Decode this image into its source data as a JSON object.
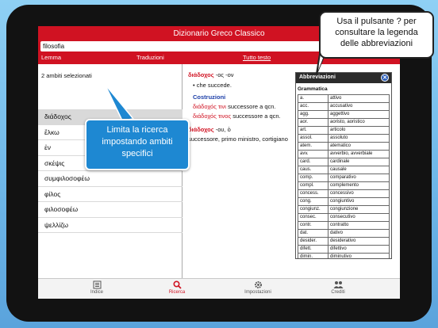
{
  "header": {
    "title": "Dizionario Greco Classico"
  },
  "search": {
    "value": "filosofia"
  },
  "tabs": [
    {
      "label": "Lemma"
    },
    {
      "label": "Traduzioni"
    },
    {
      "label": "Tutto testo"
    }
  ],
  "left_pane": {
    "ambiti_label": "2 ambiti selezionati",
    "words": [
      "διάδοχος",
      "ἕλκω",
      "ἐν",
      "σκέψις",
      "συμφιλοσοφέω",
      "φίλος",
      "φιλοσοφέω",
      "ψελλίζω"
    ]
  },
  "entry": {
    "headword": "διάδοχος",
    "inflection": "-ος -ον",
    "bullet": "• che succede.",
    "costruzioni_label": "Costruzioni",
    "constructions": [
      {
        "greek": "διάδοχός τινι",
        "translation": "successore a qcn."
      },
      {
        "greek": "διάδοχός τινος",
        "translation": "successore a qcn."
      }
    ],
    "noun_headword": "διάδοχος",
    "noun_inflection": "-ου, ὁ",
    "noun_meaning": "successore, primo ministro, cortigiano"
  },
  "abbreviations": {
    "title": "Abbreviazioni",
    "close_icon": "close-icon",
    "section": "Grammatica",
    "rows": [
      [
        "a.",
        "attivo"
      ],
      [
        "acc.",
        "accusativo"
      ],
      [
        "agg.",
        "aggettivo"
      ],
      [
        "aor.",
        "aoristo, aoristico"
      ],
      [
        "art.",
        "articolo"
      ],
      [
        "assol.",
        "assoluto"
      ],
      [
        "atem.",
        "atematico"
      ],
      [
        "avv.",
        "avverbio, avverbiale"
      ],
      [
        "card.",
        "cardinale"
      ],
      [
        "caus.",
        "causale"
      ],
      [
        "comp.",
        "comparativo"
      ],
      [
        "compl.",
        "complemento"
      ],
      [
        "concess.",
        "concessivo"
      ],
      [
        "cong.",
        "congiuntivo"
      ],
      [
        "congiunz.",
        "congiunzione"
      ],
      [
        "consec.",
        "consecutivo"
      ],
      [
        "contr.",
        "contratto"
      ],
      [
        "dat.",
        "dativo"
      ],
      [
        "desider.",
        "desiderativo"
      ],
      [
        "difett.",
        "difettivo"
      ],
      [
        "dimin.",
        "diminutivo"
      ],
      [
        "dimostr.",
        "dimostrativo"
      ]
    ]
  },
  "tabbar": [
    {
      "label": "Indice",
      "icon": "index-icon"
    },
    {
      "label": "Ricerca",
      "icon": "search-icon"
    },
    {
      "label": "Impostazioni",
      "icon": "gear-icon"
    },
    {
      "label": "Crediti",
      "icon": "people-icon"
    }
  ],
  "callouts": {
    "top_lines": [
      "Usa il pulsante ? per",
      "consultare la legenda",
      "delle abbreviazioni"
    ],
    "blue_lines": [
      "Limita la ricerca",
      "impostando ambiti",
      "specifici"
    ]
  },
  "colors": {
    "accent": "#d01222",
    "callout_blue": "#1e88d2",
    "background": "#7cc3ee"
  }
}
